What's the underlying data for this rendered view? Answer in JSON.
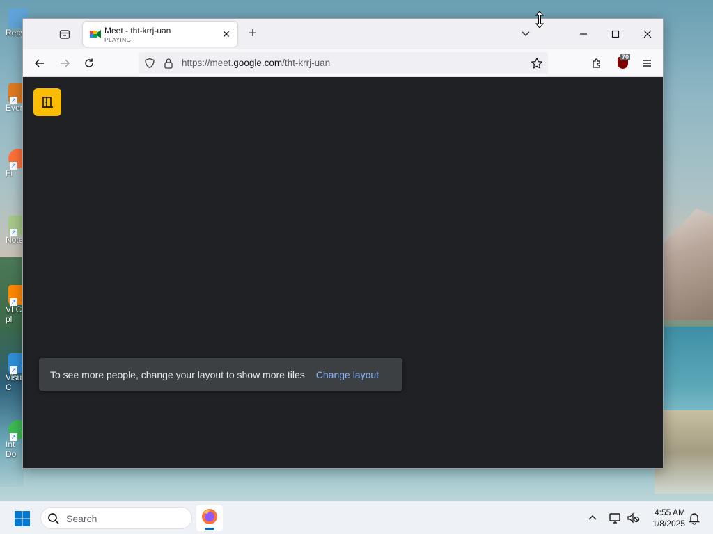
{
  "desktop": {
    "icons": [
      {
        "label": "Recy",
        "color": "#4a90c8"
      },
      {
        "label": "Ever",
        "color": "#e07a1f"
      },
      {
        "label": "Fi",
        "color": "#ff7139"
      },
      {
        "label": "Note",
        "color": "#8bc34a"
      },
      {
        "label": "VLC\npl",
        "color": "#ff8800"
      },
      {
        "label": "Visua\nC",
        "color": "#2f8fd8"
      },
      {
        "label": "Int\nDo",
        "color": "#3cba54"
      }
    ]
  },
  "browser": {
    "tab": {
      "title": "Meet - tht-krrj-uan",
      "status": "PLAYING",
      "favicon": "google-meet-icon"
    },
    "url": {
      "prefix": "https://meet.",
      "domain": "google.com",
      "path": "/tht-krrj-uan"
    },
    "ublock_badge": "70"
  },
  "meet": {
    "toast_message": "To see more people, change your layout to show more tiles",
    "toast_action": "Change layout",
    "exit_icon": "door-exit-icon"
  },
  "taskbar": {
    "search_placeholder": "Search",
    "time": "4:55 AM",
    "date": "1/8/2025"
  },
  "colors": {
    "meet_bg": "#202124",
    "accent_yellow": "#fbbc04",
    "toast_link": "#8ab4f8"
  }
}
